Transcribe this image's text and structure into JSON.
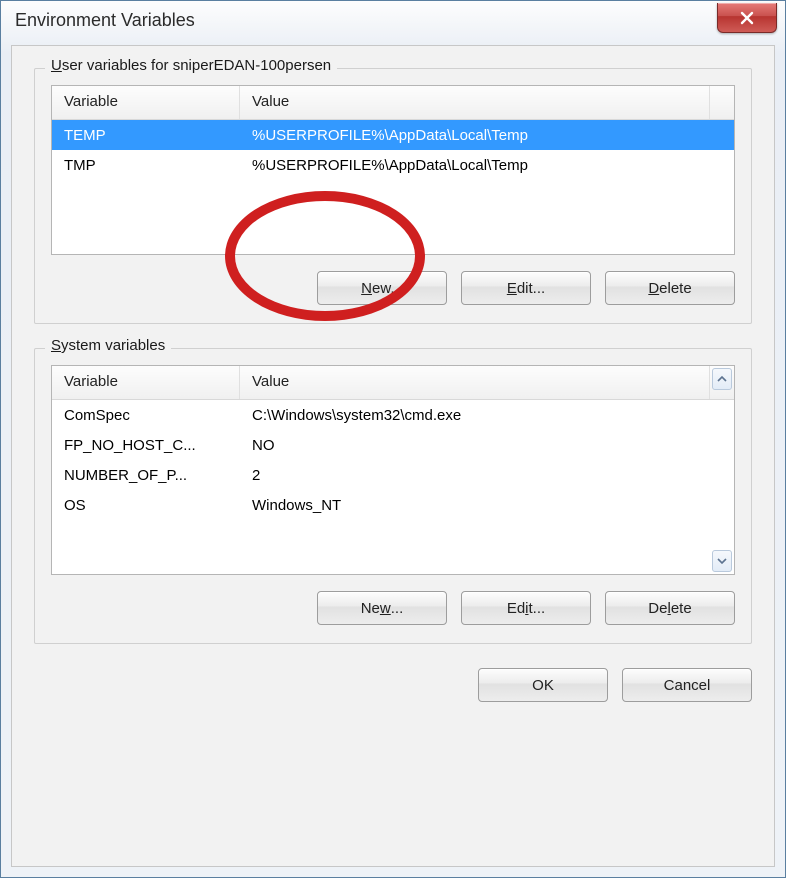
{
  "window": {
    "title": "Environment Variables"
  },
  "user_section": {
    "title_prefix": "U",
    "title_rest": "ser variables for sniperEDAN-100persen",
    "columns": {
      "variable": "Variable",
      "value": "Value"
    },
    "rows": [
      {
        "variable": "TEMP",
        "value": "%USERPROFILE%\\AppData\\Local\\Temp",
        "selected": true
      },
      {
        "variable": "TMP",
        "value": "%USERPROFILE%\\AppData\\Local\\Temp",
        "selected": false
      }
    ],
    "buttons": {
      "new_u": "N",
      "new_rest": "ew...",
      "edit_u": "E",
      "edit_rest": "dit...",
      "delete_u": "D",
      "delete_rest": "elete"
    }
  },
  "system_section": {
    "title_prefix": "S",
    "title_rest": "ystem variables",
    "columns": {
      "variable": "Variable",
      "value": "Value"
    },
    "rows": [
      {
        "variable": "ComSpec",
        "value": "C:\\Windows\\system32\\cmd.exe"
      },
      {
        "variable": "FP_NO_HOST_C...",
        "value": "NO"
      },
      {
        "variable": "NUMBER_OF_P...",
        "value": "2"
      },
      {
        "variable": "OS",
        "value": "Windows_NT"
      }
    ],
    "buttons": {
      "new_u": "w",
      "new_label": "New...",
      "edit_u": "i",
      "edit_label": "Edit...",
      "delete_u": "l",
      "delete_label": "Delete"
    }
  },
  "dialog_buttons": {
    "ok": "OK",
    "cancel": "Cancel"
  }
}
